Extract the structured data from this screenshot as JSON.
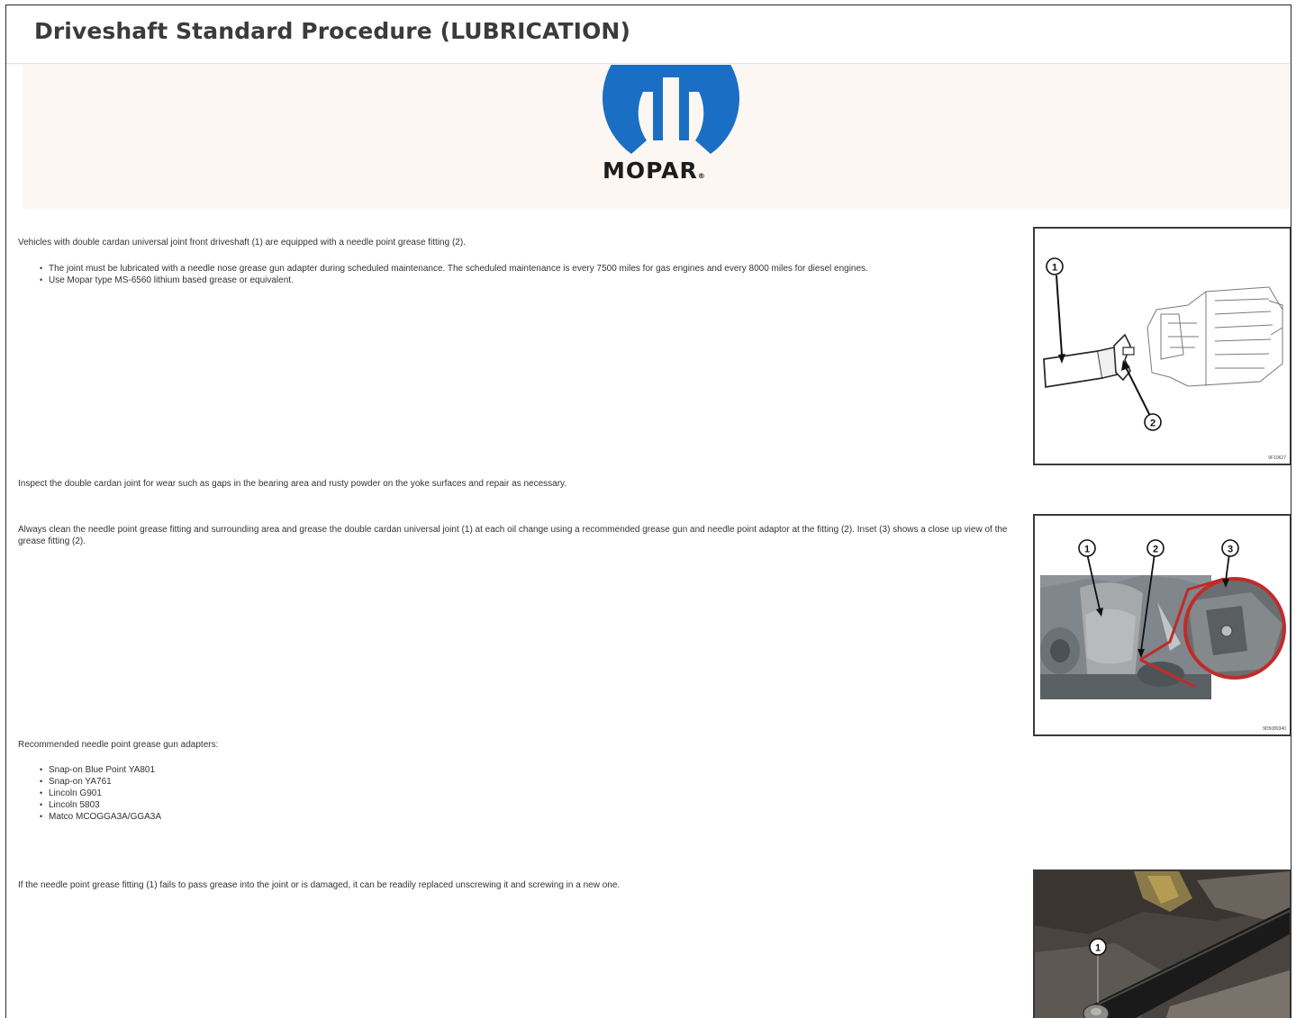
{
  "page": {
    "title": "Driveshaft Standard Procedure (LUBRICATION)"
  },
  "banner": {
    "brand": "MOPAR",
    "reg": "®",
    "brand_color": "#1a6fc4"
  },
  "sections": [
    {
      "text": "Vehicles with double cardan universal joint front driveshaft (1) are equipped with a needle point grease fitting (2).",
      "bullets": [
        "The joint must be lubricated with a needle nose grease gun adapter during scheduled maintenance. The scheduled maintenance is every 7500 miles for gas engines and every 8000 miles for diesel engines.",
        "Use Mopar type MS-6560 lithium based grease or equivalent."
      ]
    },
    {
      "text": "Inspect the double cardan joint for wear such as gaps in the bearing area and rusty powder on the yoke surfaces and repair as necessary."
    },
    {
      "text": "Always clean the needle point grease fitting and surrounding area and grease the double cardan universal joint (1) at each oil change using a recommended grease gun and needle point adaptor at the fitting (2). Inset (3) shows a close up view of the grease fitting (2)."
    },
    {
      "text": "Recommended needle point grease gun adapters:",
      "bullets": [
        "Snap-on Blue Point YA801",
        "Snap-on YA761",
        "Lincoln G901",
        "Lincoln 5803",
        "Matco MCOGGA3A/GGA3A"
      ]
    },
    {
      "text": "If the needle point grease fitting (1) fails to pass grease into the joint or is damaged, it can be readily replaced unscrewing it and screwing in a new one."
    }
  ],
  "figures": {
    "fig1": {
      "callouts": [
        "1",
        "2"
      ],
      "code": "9F10627"
    },
    "fig2": {
      "callouts": [
        "1",
        "2",
        "3"
      ],
      "code": "9D5089340"
    },
    "fig3": {
      "callouts": [
        "1"
      ]
    }
  }
}
